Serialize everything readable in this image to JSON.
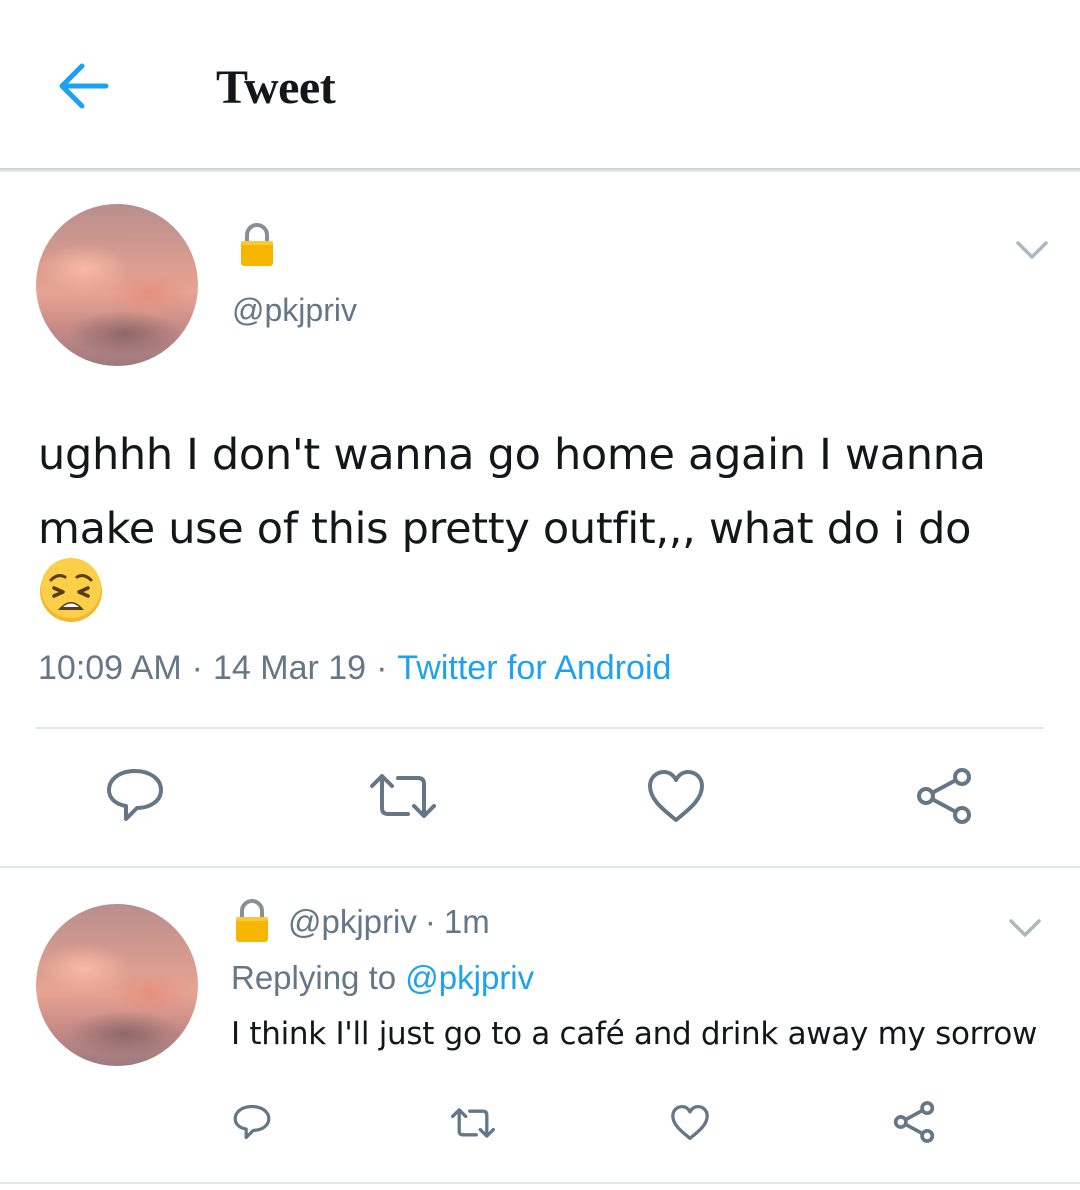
{
  "colors": {
    "accent": "#1da1f2",
    "secondary_text": "#657786",
    "primary_text": "#14171a",
    "divider": "#e1e8ed",
    "lock": "#f7b500"
  },
  "header": {
    "back_icon": "arrow-left-icon",
    "title": "Tweet"
  },
  "tweet": {
    "avatar": "sunset-sky-avatar",
    "locked_icon": "lock-icon",
    "handle": "@pkjpriv",
    "text": "ughhh I don't wanna go home again I wanna make use of this pretty outfit,,, what do i do",
    "emoji": "weary-face-emoji",
    "time": "10:09 AM",
    "date": "14 Mar 19",
    "separator": "·",
    "client": "Twitter for Android",
    "menu_icon": "chevron-down-icon",
    "actions": [
      {
        "name": "reply",
        "icon": "reply-icon"
      },
      {
        "name": "retweet",
        "icon": "retweet-icon"
      },
      {
        "name": "like",
        "icon": "heart-icon"
      },
      {
        "name": "share",
        "icon": "share-icon"
      }
    ]
  },
  "reply": {
    "avatar": "sunset-sky-avatar",
    "locked_icon": "lock-icon",
    "handle": "@pkjpriv",
    "separator": "·",
    "age": "1m",
    "replying_label": "Replying to",
    "replying_mention": "@pkjpriv",
    "text": "I think I'll just go to a café and drink away my sorrow",
    "menu_icon": "chevron-down-icon"
  }
}
